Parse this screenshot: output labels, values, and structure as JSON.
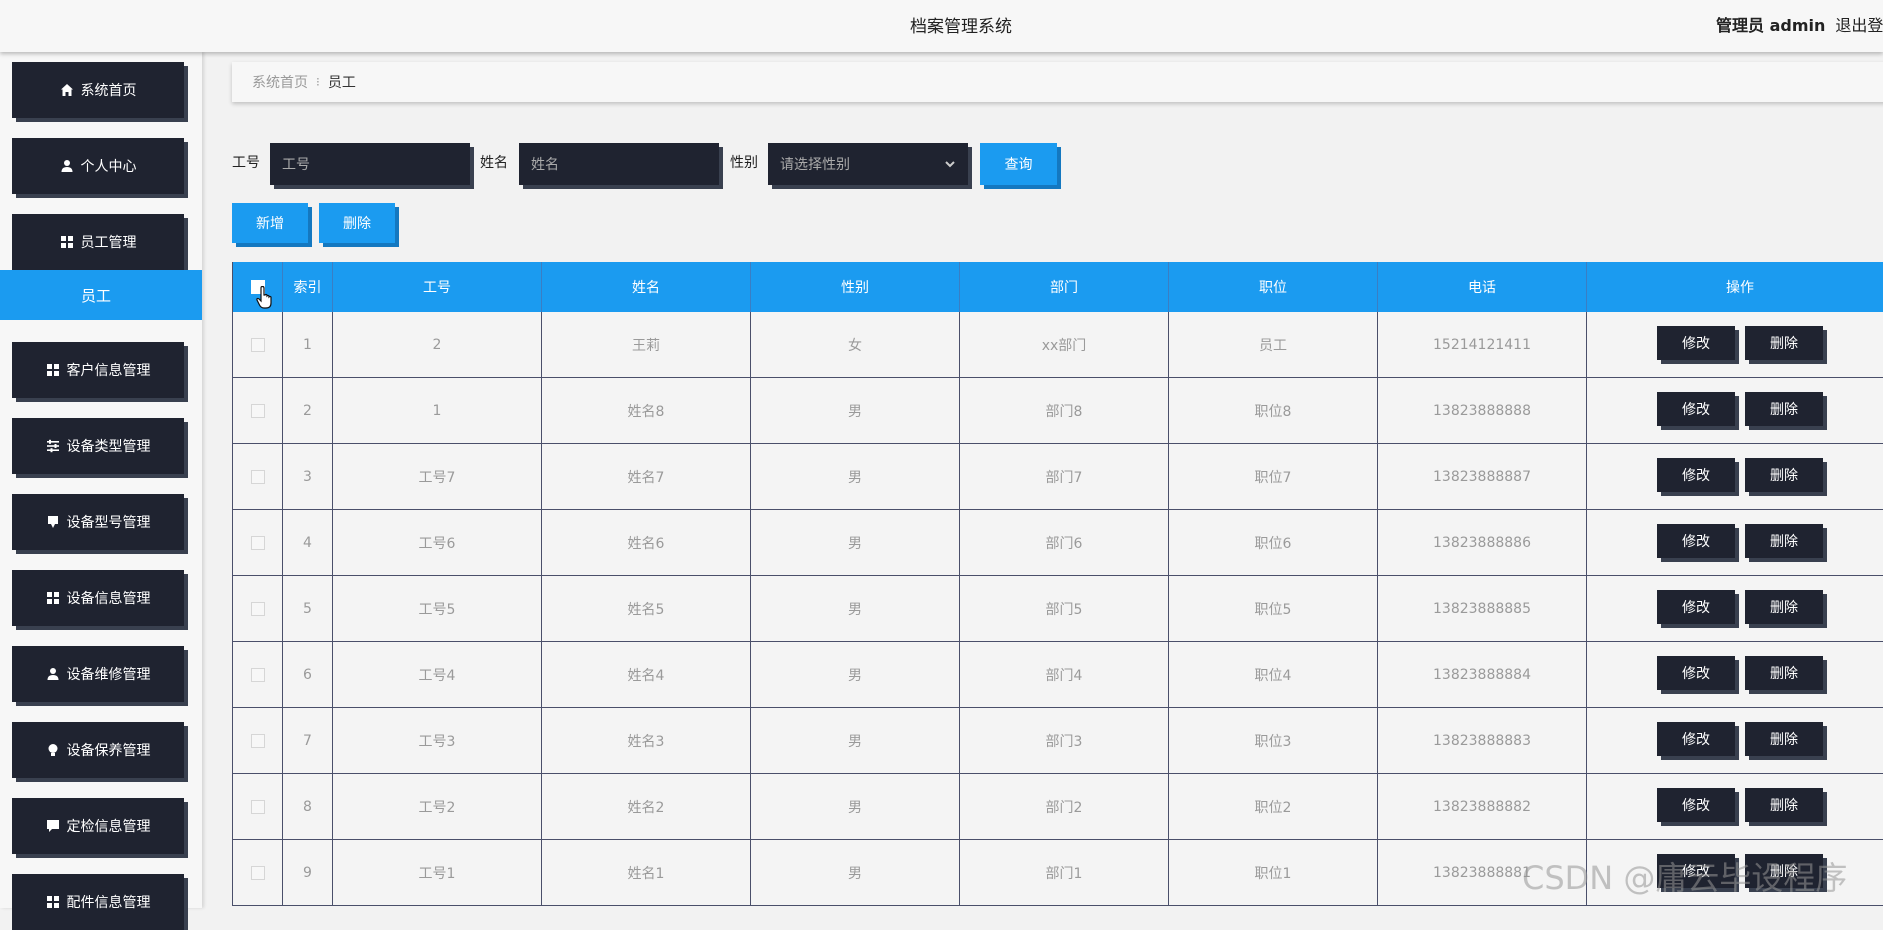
{
  "header": {
    "title": "档案管理系统",
    "user": "管理员 admin",
    "logout": "退出登录"
  },
  "sidebar": {
    "items": [
      {
        "label": "系统首页",
        "icon": "home-icon"
      },
      {
        "label": "个人中心",
        "icon": "user-icon"
      },
      {
        "label": "员工管理",
        "icon": "grid-icon"
      },
      {
        "label": "客户信息管理",
        "icon": "grid-icon"
      },
      {
        "label": "设备类型管理",
        "icon": "sliders-icon"
      },
      {
        "label": "设备型号管理",
        "icon": "tag-icon"
      },
      {
        "label": "设备信息管理",
        "icon": "grid-icon"
      },
      {
        "label": "设备维修管理",
        "icon": "user-icon"
      },
      {
        "label": "设备保养管理",
        "icon": "bulb-icon"
      },
      {
        "label": "定检信息管理",
        "icon": "chat-icon"
      },
      {
        "label": "配件信息管理",
        "icon": "grid-icon"
      }
    ],
    "active_sub": "员工"
  },
  "breadcrumb": {
    "home": "系统首页",
    "separator": "⁝",
    "current": "员工"
  },
  "search": {
    "id_label": "工号",
    "id_placeholder": "工号",
    "name_label": "姓名",
    "name_placeholder": "姓名",
    "gender_label": "性别",
    "gender_placeholder": "请选择性别",
    "query_button": "查询"
  },
  "actions": {
    "add": "新增",
    "delete": "删除"
  },
  "table": {
    "headers": [
      "索引",
      "工号",
      "姓名",
      "性别",
      "部门",
      "职位",
      "电话",
      "操作"
    ],
    "edit_label": "修改",
    "delete_label": "删除",
    "rows": [
      {
        "index": "1",
        "id": "2",
        "name": "王莉",
        "gender": "女",
        "dept": "xx部门",
        "position": "员工",
        "phone": "15214121411"
      },
      {
        "index": "2",
        "id": "1",
        "name": "姓名8",
        "gender": "男",
        "dept": "部门8",
        "position": "职位8",
        "phone": "13823888888"
      },
      {
        "index": "3",
        "id": "工号7",
        "name": "姓名7",
        "gender": "男",
        "dept": "部门7",
        "position": "职位7",
        "phone": "13823888887"
      },
      {
        "index": "4",
        "id": "工号6",
        "name": "姓名6",
        "gender": "男",
        "dept": "部门6",
        "position": "职位6",
        "phone": "13823888886"
      },
      {
        "index": "5",
        "id": "工号5",
        "name": "姓名5",
        "gender": "男",
        "dept": "部门5",
        "position": "职位5",
        "phone": "13823888885"
      },
      {
        "index": "6",
        "id": "工号4",
        "name": "姓名4",
        "gender": "男",
        "dept": "部门4",
        "position": "职位4",
        "phone": "13823888884"
      },
      {
        "index": "7",
        "id": "工号3",
        "name": "姓名3",
        "gender": "男",
        "dept": "部门3",
        "position": "职位3",
        "phone": "13823888883"
      },
      {
        "index": "8",
        "id": "工号2",
        "name": "姓名2",
        "gender": "男",
        "dept": "部门2",
        "position": "职位2",
        "phone": "13823888882"
      },
      {
        "index": "9",
        "id": "工号1",
        "name": "姓名1",
        "gender": "男",
        "dept": "部门1",
        "position": "职位1",
        "phone": "13823888881"
      }
    ]
  },
  "watermark": "CSDN @庸云毕设程序",
  "colors": {
    "accent": "#1b9bf0",
    "dark_button": "#1f2330"
  }
}
